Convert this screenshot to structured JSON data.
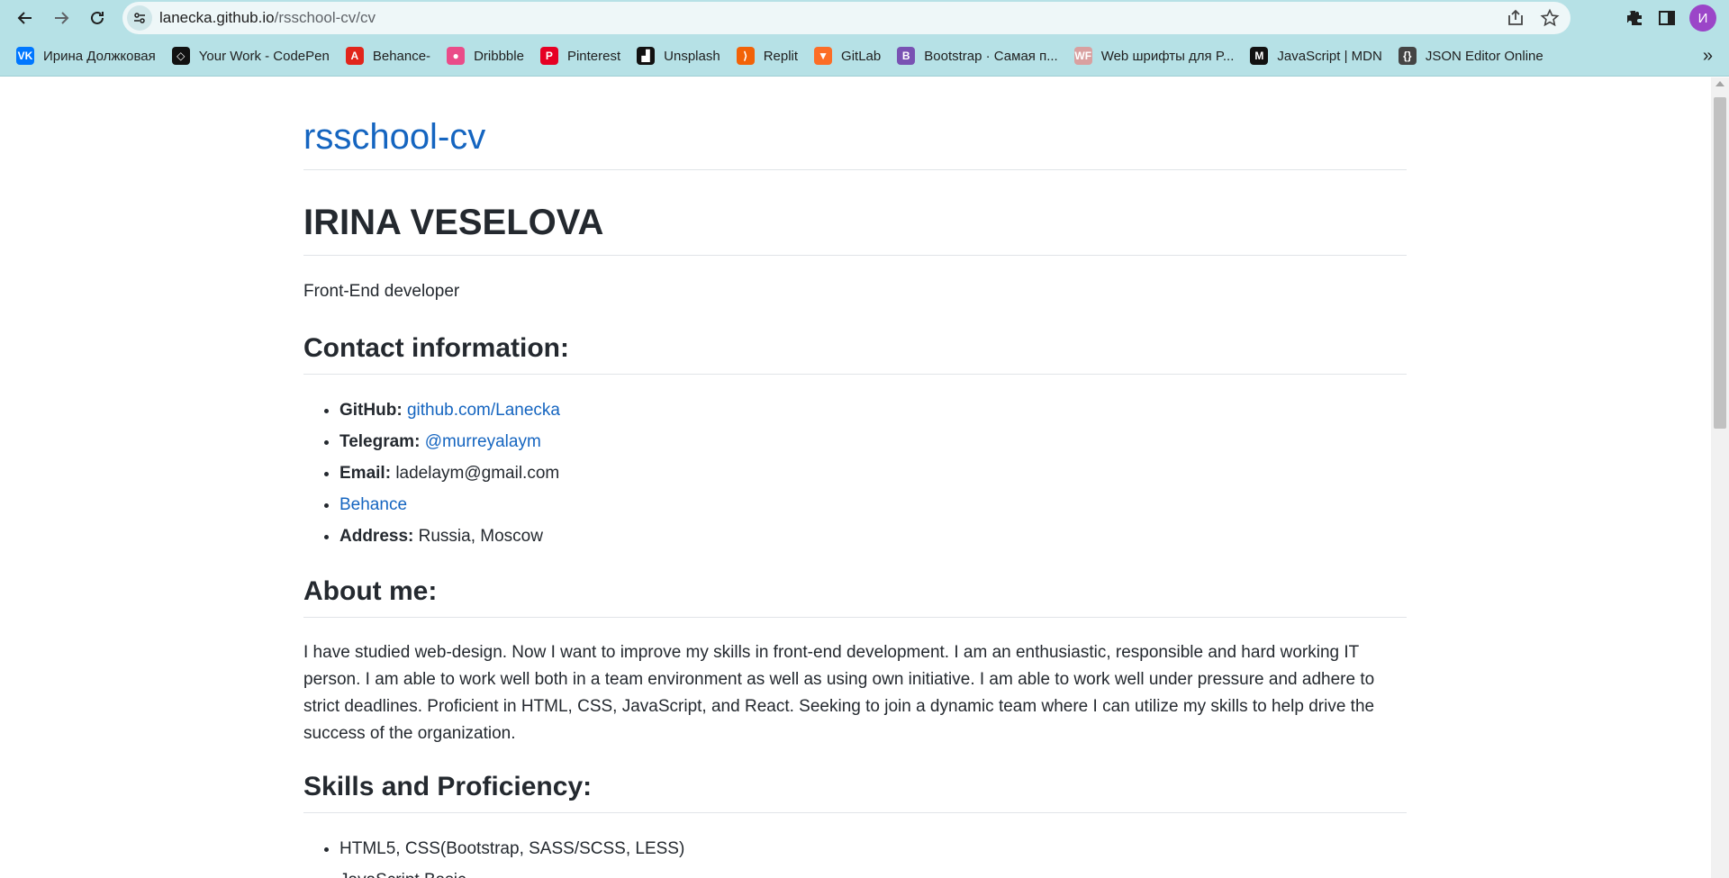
{
  "browser": {
    "url_host": "lanecka.github.io",
    "url_path": "/rsschool-cv/cv",
    "profile_initial": "И"
  },
  "bookmarks": [
    {
      "label": "Ирина Должковая",
      "icon": "vk-icon",
      "color": "#0077ff",
      "glyph": "VK"
    },
    {
      "label": "Your Work - CodePen",
      "icon": "codepen-icon",
      "color": "#111111",
      "glyph": "◇"
    },
    {
      "label": "Behance-",
      "icon": "adobe-icon",
      "color": "#e1251b",
      "glyph": "A"
    },
    {
      "label": "Dribbble",
      "icon": "dribbble-icon",
      "color": "#ea4c89",
      "glyph": "●"
    },
    {
      "label": "Pinterest",
      "icon": "pinterest-icon",
      "color": "#e60023",
      "glyph": "P"
    },
    {
      "label": "Unsplash",
      "icon": "unsplash-icon",
      "color": "#111111",
      "glyph": "▟"
    },
    {
      "label": "Replit",
      "icon": "replit-icon",
      "color": "#f26207",
      "glyph": "⟩"
    },
    {
      "label": "GitLab",
      "icon": "gitlab-icon",
      "color": "#fc6d26",
      "glyph": "▼"
    },
    {
      "label": "Bootstrap · Самая п...",
      "icon": "bootstrap-icon",
      "color": "#7952b3",
      "glyph": "B"
    },
    {
      "label": "Web шрифты для P...",
      "icon": "webfonts-icon",
      "color": "#d9a0a0",
      "glyph": "WF"
    },
    {
      "label": "JavaScript | MDN",
      "icon": "mdn-icon",
      "color": "#111111",
      "glyph": "M"
    },
    {
      "label": "JSON Editor Online",
      "icon": "json-editor-icon",
      "color": "#444444",
      "glyph": "{}"
    }
  ],
  "page": {
    "site_title": "rsschool-cv",
    "name": "IRINA VESELOVA",
    "role": "Front-End developer",
    "contact_heading": "Contact information:",
    "contacts": [
      {
        "label": "GitHub:",
        "value": "github.com/Lanecka",
        "is_link": true
      },
      {
        "label": "Telegram:",
        "value": "@murreyalaym",
        "is_link": true
      },
      {
        "label": "Email:",
        "value": "ladelaym@gmail.com",
        "is_link": false
      },
      {
        "label": "",
        "value": "Behance",
        "is_link": true
      },
      {
        "label": "Address:",
        "value": "Russia, Moscow",
        "is_link": false
      }
    ],
    "about_heading": "About me:",
    "about_text": "I have studied web-design. Now I want to improve my skills in front-end development. I am an enthusiastic, responsible and hard working IT person. I am able to work well both in a team environment as well as using own initiative. I am able to work well under pressure and adhere to strict deadlines. Proficient in HTML, CSS, JavaScript, and React. Seeking to join a dynamic team where I can utilize my skills to help drive the success of the organization.",
    "skills_heading": "Skills and Proficiency:",
    "skills": [
      "HTML5, CSS(Bootstrap, SASS/SCSS, LESS)",
      "JavaScript Basic"
    ]
  },
  "colors": {
    "chrome_bg": "#b6e1e6",
    "link": "#1565c0",
    "text": "#24292f"
  }
}
